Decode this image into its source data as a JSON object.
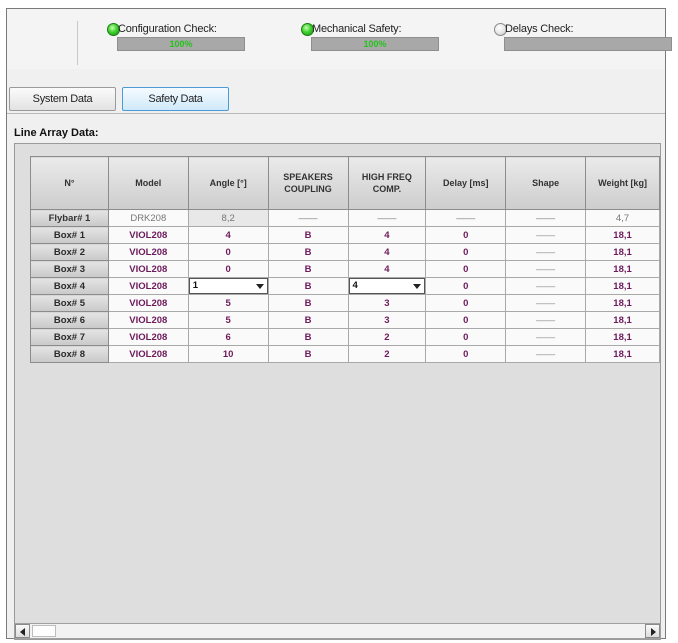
{
  "status": {
    "checks": [
      {
        "label": "Configuration Check:",
        "state": "ok",
        "percent": "100%"
      },
      {
        "label": "Mechanical Safety:",
        "state": "ok",
        "percent": "100%"
      },
      {
        "label": "Delays Check:",
        "state": "off",
        "percent": ""
      }
    ],
    "colors": {
      "ok": "#3fd22e",
      "off": "#d9d9d9"
    }
  },
  "tabs": [
    {
      "label": "System Data",
      "active": false
    },
    {
      "label": "Safety Data",
      "active": true
    }
  ],
  "section_title": "Line Array Data:",
  "table": {
    "headers": [
      "N°",
      "Model",
      "Angle [°]",
      "SPEAKERS COUPLING",
      "HIGH FREQ COMP.",
      "Delay [ms]",
      "Shape",
      "Weight [kg]"
    ],
    "rows": [
      {
        "name": "Flybar# 1",
        "model": "DRK208",
        "angle": "8,2",
        "coupling": "——",
        "hf": "——",
        "delay": "——",
        "shape": "——",
        "weight": "4,7"
      },
      {
        "name": "Box# 1",
        "model": "VIOL208",
        "angle": "4",
        "coupling": "B",
        "hf": "4",
        "delay": "0",
        "shape": "——",
        "weight": "18,1"
      },
      {
        "name": "Box# 2",
        "model": "VIOL208",
        "angle": "0",
        "coupling": "B",
        "hf": "4",
        "delay": "0",
        "shape": "——",
        "weight": "18,1"
      },
      {
        "name": "Box# 3",
        "model": "VIOL208",
        "angle": "0",
        "coupling": "B",
        "hf": "4",
        "delay": "0",
        "shape": "——",
        "weight": "18,1"
      },
      {
        "name": "Box# 4",
        "model": "VIOL208",
        "angle": "1",
        "coupling": "B",
        "hf": "4",
        "delay": "0",
        "shape": "——",
        "weight": "18,1"
      },
      {
        "name": "Box# 5",
        "model": "VIOL208",
        "angle": "5",
        "coupling": "B",
        "hf": "3",
        "delay": "0",
        "shape": "——",
        "weight": "18,1"
      },
      {
        "name": "Box# 6",
        "model": "VIOL208",
        "angle": "5",
        "coupling": "B",
        "hf": "3",
        "delay": "0",
        "shape": "——",
        "weight": "18,1"
      },
      {
        "name": "Box# 7",
        "model": "VIOL208",
        "angle": "6",
        "coupling": "B",
        "hf": "2",
        "delay": "0",
        "shape": "——",
        "weight": "18,1"
      },
      {
        "name": "Box# 8",
        "model": "VIOL208",
        "angle": "10",
        "coupling": "B",
        "hf": "2",
        "delay": "0",
        "shape": "——",
        "weight": "18,1"
      }
    ]
  },
  "icons": {
    "status_ok": "status-led-green-icon",
    "status_off": "status-led-grey-icon",
    "dropdown": "chevron-down-icon",
    "scroll_left": "arrow-left-icon",
    "scroll_right": "arrow-right-icon"
  }
}
